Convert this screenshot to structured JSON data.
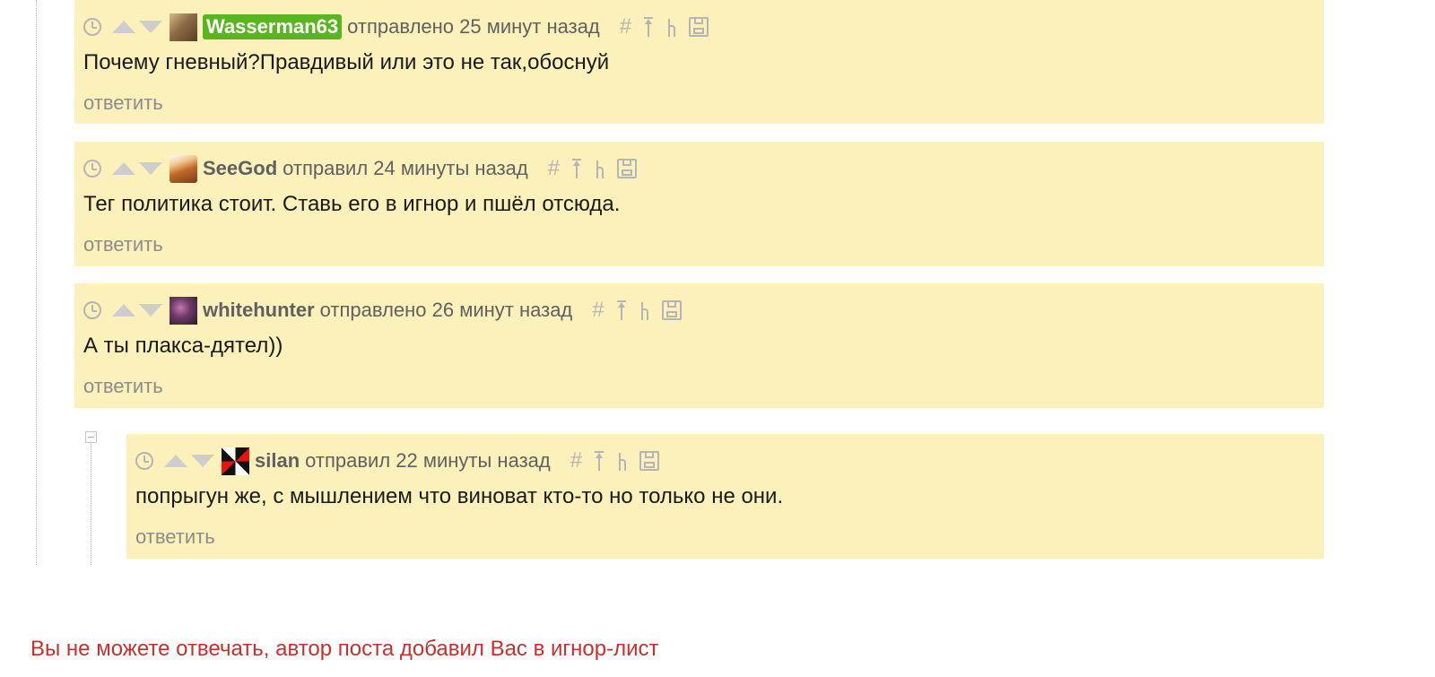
{
  "comments": [
    {
      "username": "Wasserman63",
      "meta": "отправлено 25 минут назад",
      "text": "Почему гневный?Правдивый или это не так,обоснуй",
      "reply": "ответить",
      "avatar": "avatar-icon"
    },
    {
      "username": "SeeGod",
      "meta": "отправил 24 минуты назад",
      "text": "Тег политика стоит. Ставь его в игнор и пшёл отсюда.",
      "reply": "ответить",
      "avatar": "avatar-icon"
    },
    {
      "username": "whitehunter",
      "meta": "отправлено 26 минут назад",
      "text": "А ты плакса-дятел))",
      "reply": "ответить",
      "avatar": "avatar-icon"
    },
    {
      "username": "silan",
      "meta": "отправил 22 минуты назад",
      "text": "попрыгун же, с мышлением что виноват кто-то но только не они.",
      "reply": "ответить",
      "avatar": "avatar-icon"
    }
  ],
  "toolbar": {
    "anchor_glyph": "#",
    "icons": [
      "clock-icon",
      "vote-up-icon",
      "vote-down-icon",
      "anchor-icon",
      "go-to-parent-icon",
      "branch-icon",
      "save-icon"
    ]
  },
  "notice": "Вы не можете отвечать, автор поста добавил Вас в игнор-лист",
  "colors": {
    "comment_bg": "#fcf0bb",
    "highlight_username_bg": "#5ab620",
    "notice": "#c9302c",
    "reply_link": "#8c8c8c"
  }
}
